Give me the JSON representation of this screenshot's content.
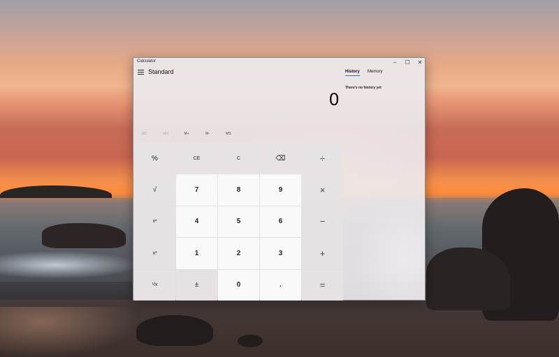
{
  "window": {
    "title": "Calculator",
    "controls": {
      "minimize": "–",
      "maximize": "☐",
      "close": "✕"
    }
  },
  "header": {
    "mode": "Standard"
  },
  "display": {
    "value": "0"
  },
  "memory": {
    "buttons": [
      "MC",
      "MR",
      "M+",
      "M-",
      "MS"
    ]
  },
  "keypad": [
    [
      "%",
      "CE",
      "C",
      "⌫",
      "÷"
    ],
    [
      "√",
      "7",
      "8",
      "9",
      "×"
    ],
    [
      "x²",
      "4",
      "5",
      "6",
      "−"
    ],
    [
      "x³",
      "1",
      "2",
      "3",
      "+"
    ],
    [
      "¹/x",
      "±",
      "0",
      ".",
      "="
    ]
  ],
  "panel": {
    "tabs": [
      "History",
      "Memory"
    ],
    "active_tab": "History",
    "empty_message": "There's no history yet"
  }
}
